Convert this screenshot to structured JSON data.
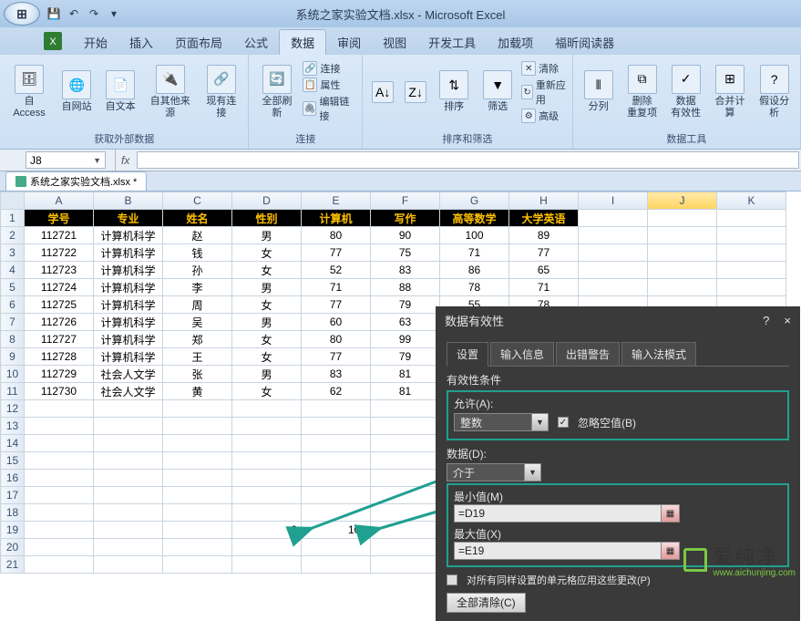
{
  "title": "系统之家实验文档.xlsx - Microsoft Excel",
  "tabs": {
    "t0": "开始",
    "t1": "插入",
    "t2": "页面布局",
    "t3": "公式",
    "t4": "数据",
    "t5": "审阅",
    "t6": "视图",
    "t7": "开发工具",
    "t8": "加载项",
    "t9": "福昕阅读器"
  },
  "ribbon": {
    "g1": {
      "b0": "自 Access",
      "b1": "自网站",
      "b2": "自文本",
      "b3": "自其他来源",
      "b4": "现有连接",
      "label": "获取外部数据"
    },
    "g2": {
      "b0": "全部刷新",
      "r0": "连接",
      "r1": "属性",
      "r2": "编辑链接",
      "label": "连接"
    },
    "g3": {
      "b0": "排序",
      "b1": "筛选",
      "r0": "清除",
      "r1": "重新应用",
      "r2": "高级",
      "label": "排序和筛选"
    },
    "g4": {
      "b0": "分列",
      "b1": "删除\n重复项",
      "b2": "数据\n有效性",
      "b3": "合并计算",
      "b4": "假设分析",
      "label": "数据工具"
    }
  },
  "name_box": "J8",
  "fx": "fx",
  "workbook_tab": "系统之家实验文档.xlsx *",
  "cols": [
    "A",
    "B",
    "C",
    "D",
    "E",
    "F",
    "G",
    "H",
    "I",
    "J",
    "K"
  ],
  "headers": [
    "学号",
    "专业",
    "姓名",
    "性别",
    "计算机",
    "写作",
    "高等数学",
    "大学英语"
  ],
  "rows": [
    [
      "112721",
      "计算机科学",
      "赵",
      "男",
      "80",
      "90",
      "100",
      "89"
    ],
    [
      "112722",
      "计算机科学",
      "钱",
      "女",
      "77",
      "75",
      "71",
      "77"
    ],
    [
      "112723",
      "计算机科学",
      "孙",
      "女",
      "52",
      "83",
      "86",
      "65"
    ],
    [
      "112724",
      "计算机科学",
      "李",
      "男",
      "71",
      "88",
      "78",
      "71"
    ],
    [
      "112725",
      "计算机科学",
      "周",
      "女",
      "77",
      "79",
      "55",
      "78"
    ],
    [
      "112726",
      "计算机科学",
      "吴",
      "男",
      "60",
      "63",
      "",
      "",
      ""
    ],
    [
      "112727",
      "计算机科学",
      "郑",
      "女",
      "80",
      "99",
      "",
      "",
      ""
    ],
    [
      "112728",
      "计算机科学",
      "王",
      "女",
      "77",
      "79",
      "",
      "",
      ""
    ],
    [
      "112729",
      "社会人文学",
      "张",
      "男",
      "83",
      "81",
      "",
      "",
      ""
    ],
    [
      "112730",
      "社会人文学",
      "黄",
      "女",
      "62",
      "81",
      "",
      "",
      ""
    ]
  ],
  "extra": {
    "D19": "0",
    "E19": "100"
  },
  "dlg": {
    "title": "数据有效性",
    "help": "?",
    "close": "×",
    "tabs": {
      "t0": "设置",
      "t1": "输入信息",
      "t2": "出错警告",
      "t3": "输入法模式"
    },
    "cond": "有效性条件",
    "allow_lbl": "允许(A):",
    "allow_val": "整数",
    "ignore": "忽略空值(B)",
    "data_lbl": "数据(D):",
    "data_val": "介于",
    "min_lbl": "最小值(M)",
    "min_val": "=D19",
    "max_lbl": "最大值(X)",
    "max_val": "=E19",
    "share": "对所有同样设置的单元格应用这些更改(P)",
    "clear": "全部清除(C)"
  },
  "wmk": {
    "main": "爱纯净",
    "sub": "www.aichunjing.com"
  }
}
